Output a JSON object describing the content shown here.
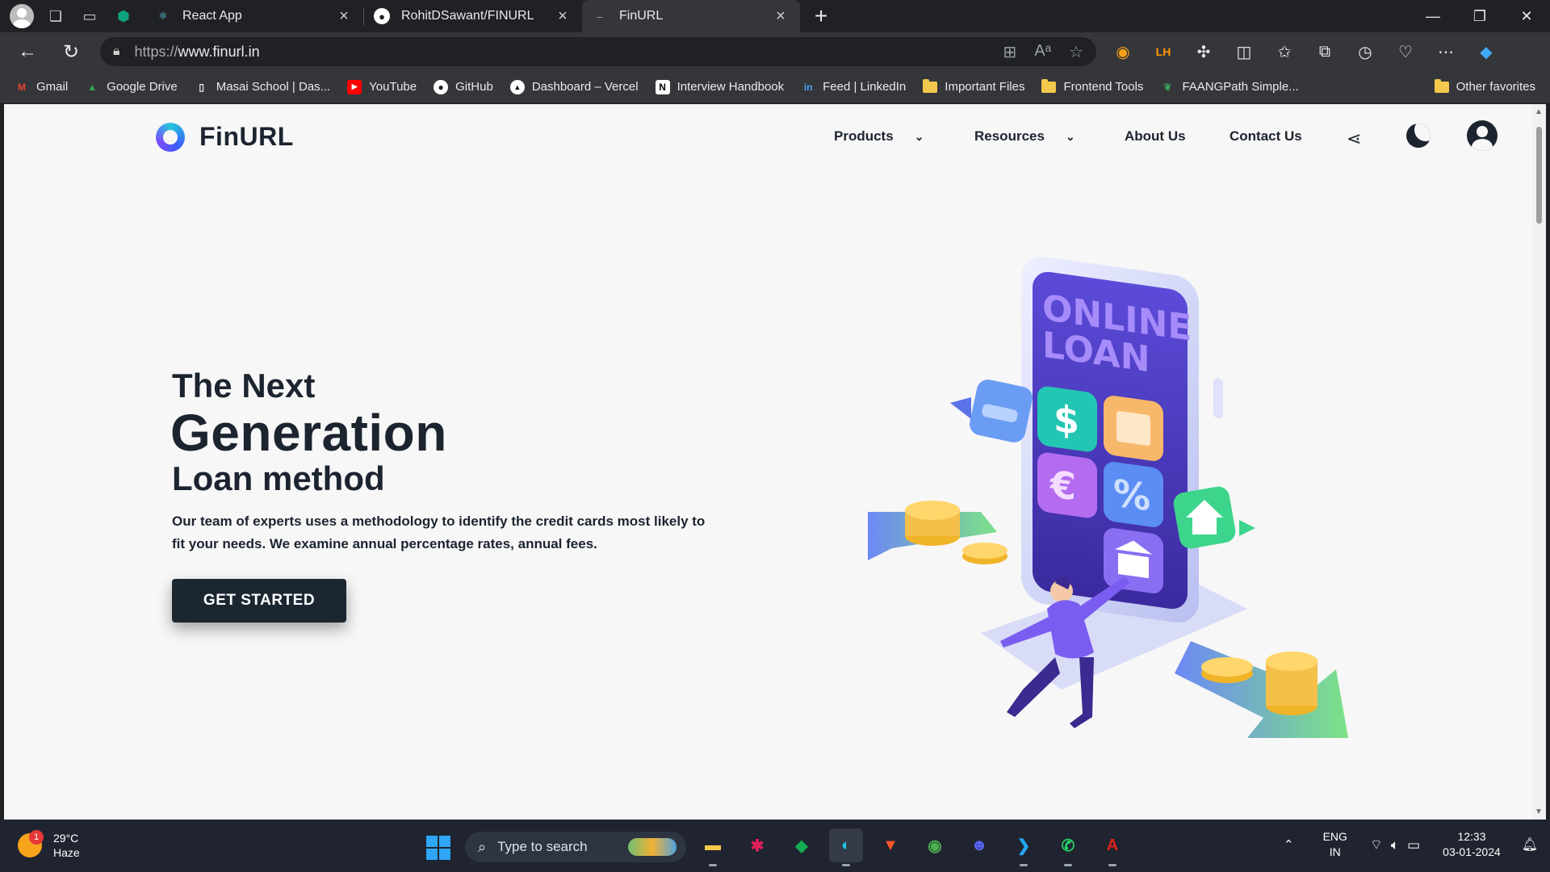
{
  "browser": {
    "tabs": [
      {
        "title": "React App",
        "favicon": "react-icon",
        "color": "#61dafb"
      },
      {
        "title": "RohitDSawant/FINURL",
        "favicon": "github-icon",
        "color": "#ffffff"
      },
      {
        "title": "FinURL",
        "favicon": "dash-icon",
        "color": "#9aa0a6",
        "active": true
      }
    ],
    "url": {
      "scheme": "https://",
      "host": "www.finurl.in"
    },
    "bookmarks": [
      {
        "label": "Gmail",
        "icon": "gmail-icon",
        "color": "#ea4335"
      },
      {
        "label": "Google Drive",
        "icon": "drive-icon",
        "color": "#34a853"
      },
      {
        "label": "Masai School | Das...",
        "icon": "page-icon",
        "color": "#e8eaed"
      },
      {
        "label": "YouTube",
        "icon": "youtube-icon",
        "color": "#ff0000"
      },
      {
        "label": "GitHub",
        "icon": "github-icon",
        "color": "#ffffff"
      },
      {
        "label": "Dashboard – Vercel",
        "icon": "vercel-icon",
        "color": "#ffffff"
      },
      {
        "label": "Interview Handbook",
        "icon": "notion-icon",
        "color": "#ffffff"
      },
      {
        "label": "Feed | LinkedIn",
        "icon": "linkedin-icon",
        "color": "#0a66c2"
      },
      {
        "label": "Important Files",
        "icon": "folder-icon",
        "color": "#f2c94c"
      },
      {
        "label": "Frontend Tools",
        "icon": "folder-icon",
        "color": "#f2c94c"
      },
      {
        "label": "FAANGPath Simple...",
        "icon": "leaf-icon",
        "color": "#3ba55d"
      }
    ],
    "other_favorites": "Other favorites"
  },
  "site": {
    "brand": "FinURL",
    "nav": {
      "products": "Products",
      "resources": "Resources",
      "about": "About Us",
      "contact": "Contact Us"
    },
    "hero": {
      "line1": "The Next",
      "line2": "Generation",
      "line3": "Loan method",
      "description": "Our team of experts uses a methodology to identify the credit cards most likely to fit your needs. We examine annual percentage rates, annual fees.",
      "cta": "GET STARTED"
    },
    "illustration": {
      "screen_text_1": "ONLINE",
      "screen_text_2": "LOAN",
      "tiles": [
        "$",
        "€",
        "%"
      ]
    }
  },
  "taskbar": {
    "weather": {
      "temp": "29°C",
      "condition": "Haze",
      "badge": "1"
    },
    "search_placeholder": "Type to search",
    "apps": [
      {
        "name": "file-explorer-icon",
        "glyph": "▬",
        "color": "#f7c948",
        "running": true
      },
      {
        "name": "slack-icon",
        "glyph": "✱",
        "color": "#e01e5a"
      },
      {
        "name": "mongodb-compass-icon",
        "glyph": "◆",
        "color": "#13aa52"
      },
      {
        "name": "edge-icon",
        "glyph": "◐",
        "color": "#1ec5e5",
        "running": true,
        "active": true
      },
      {
        "name": "brave-icon",
        "glyph": "▼",
        "color": "#fb542b"
      },
      {
        "name": "chrome-icon",
        "glyph": "◉",
        "color": "#4caf50"
      },
      {
        "name": "discord-icon",
        "glyph": "☻",
        "color": "#5865f2"
      },
      {
        "name": "vscode-icon",
        "glyph": "❯",
        "color": "#22a7f0",
        "running": true
      },
      {
        "name": "whatsapp-icon",
        "glyph": "✆",
        "color": "#25d366",
        "running": true
      },
      {
        "name": "acrobat-icon",
        "glyph": "A",
        "color": "#e2231a",
        "running": true
      }
    ],
    "lang": {
      "top": "ENG",
      "bottom": "IN"
    },
    "clock": {
      "time": "12:33",
      "date": "03-01-2024"
    }
  }
}
